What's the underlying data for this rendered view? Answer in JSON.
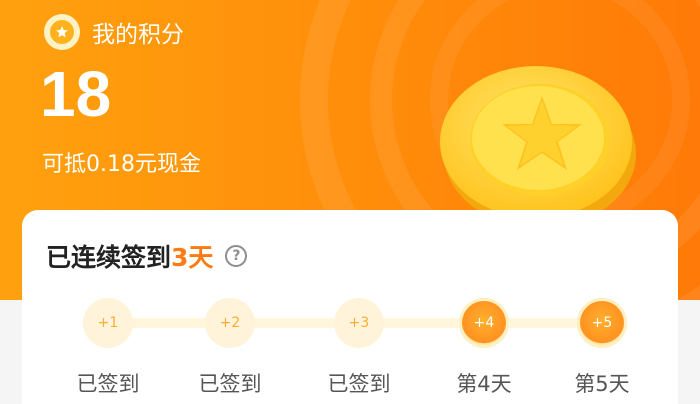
{
  "header": {
    "title": "我的积分",
    "points": "18",
    "cash_note": "可抵0.18元现金"
  },
  "checkin": {
    "title_prefix": "已连续签到",
    "days": "3天",
    "help_glyph": "?",
    "steps": [
      {
        "reward": "+1",
        "label": "已签到",
        "state": "done"
      },
      {
        "reward": "+2",
        "label": "已签到",
        "state": "done"
      },
      {
        "reward": "+3",
        "label": "已签到",
        "state": "done"
      },
      {
        "reward": "+4",
        "label": "第4天",
        "state": "pending"
      },
      {
        "reward": "+5",
        "label": "第5天",
        "state": "pending"
      }
    ]
  },
  "colors": {
    "accent": "#ff8c0a",
    "highlight": "#ff7a10",
    "coin": "#ffd43a"
  },
  "icons": [
    "points-badge-icon",
    "star-coin-icon",
    "help-icon"
  ]
}
